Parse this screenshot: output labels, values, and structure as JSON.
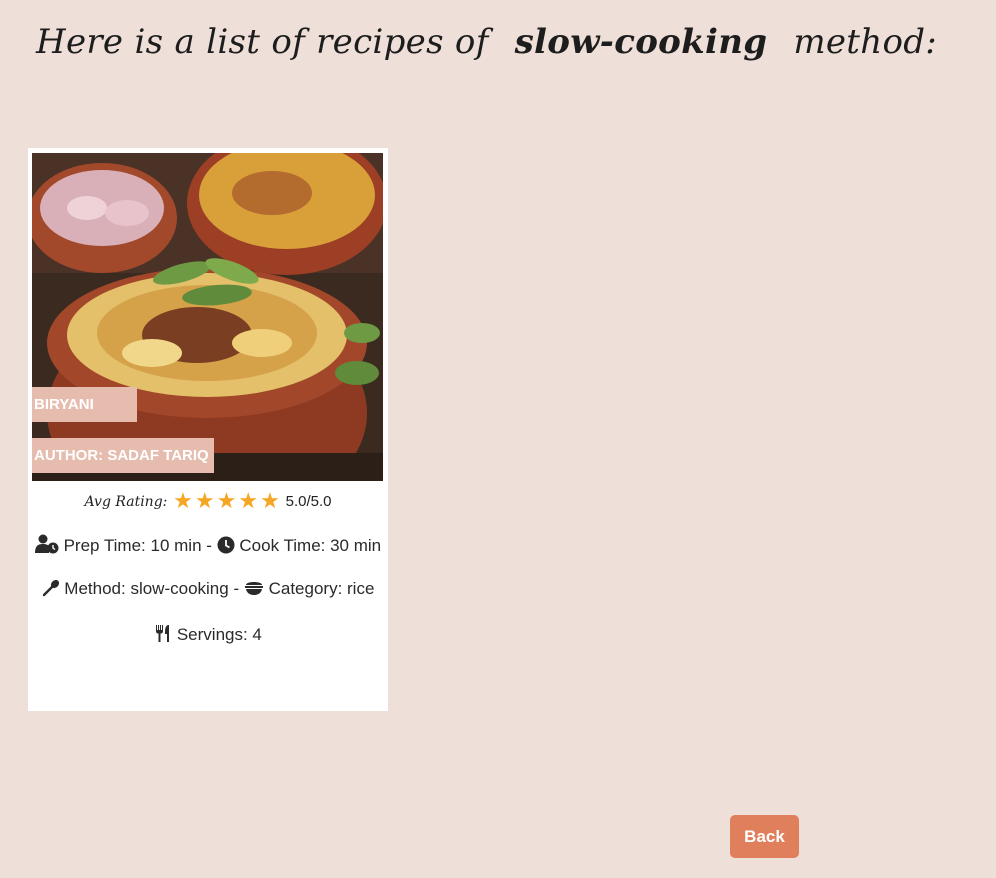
{
  "page": {
    "heading_prefix": "Here is a list of recipes of",
    "method": "slow-cooking",
    "heading_suffix": "method:"
  },
  "recipe": {
    "name": "BIRYANI",
    "author": "AUTHOR: SADAF TARIQ",
    "rating_label": "Avg Rating:",
    "rating_stars": 5,
    "rating_value": "5.0/5.0",
    "prep_time": "Prep Time: 10 min",
    "cook_time": "Cook Time: 30 min",
    "method": "Method: slow-cooking",
    "category": "Category: rice",
    "servings": "Servings: 4",
    "separator": "-",
    "icons": {
      "prep": "user-clock-icon",
      "cook": "clock-icon",
      "method": "spoon-icon",
      "category": "bowl-icon",
      "servings": "utensils-icon",
      "star": "star-icon"
    }
  },
  "actions": {
    "back": "Back"
  },
  "colors": {
    "background": "#efdfd9",
    "card": "#ffffff",
    "tag": "#e6bcae",
    "star": "#f5a623",
    "back_button": "#e07f5b"
  }
}
